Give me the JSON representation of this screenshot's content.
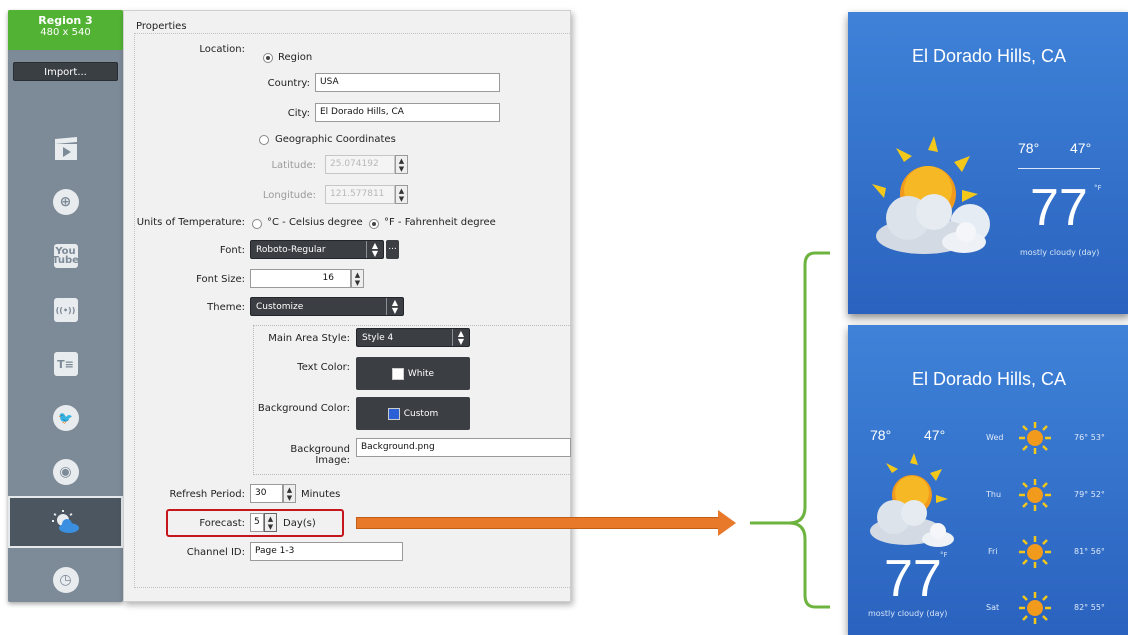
{
  "region": {
    "title": "Region 3",
    "size": "480 x 540"
  },
  "sidebar": {
    "import_label": "Import...",
    "items": [
      {
        "icon": "video-clapper-icon"
      },
      {
        "icon": "globe-icon",
        "glyph": "⊕"
      },
      {
        "icon": "youtube-icon",
        "glyph": "You Tube"
      },
      {
        "icon": "broadcast-icon",
        "glyph": "((•))"
      },
      {
        "icon": "text-icon",
        "glyph": "T≡"
      },
      {
        "icon": "twitter-icon",
        "glyph": "🐦"
      },
      {
        "icon": "rss-icon",
        "glyph": "◉"
      },
      {
        "icon": "weather-icon",
        "selected": true
      },
      {
        "icon": "clock-icon",
        "glyph": "◷"
      }
    ]
  },
  "properties": {
    "title": "Properties",
    "location_label": "Location:",
    "region_option": "Region",
    "country_label": "Country:",
    "country_value": "USA",
    "city_label": "City:",
    "city_value": "El Dorado Hills, CA",
    "geo_option": "Geographic Coordinates",
    "latitude_label": "Latitude:",
    "latitude_value": "25.074192",
    "longitude_label": "Longitude:",
    "longitude_value": "121.577811",
    "units_label": "Units of Temperature:",
    "celsius_option": "°C - Celsius degree",
    "fahrenheit_option": "°F - Fahrenheit degree",
    "font_label": "Font:",
    "font_value": "Roboto-Regular",
    "font_more": "...",
    "font_size_label": "Font Size:",
    "font_size_value": "16",
    "theme_label": "Theme:",
    "theme_value": "Customize",
    "main_area_label": "Main Area Style:",
    "main_area_value": "Style 4",
    "text_color_label": "Text Color:",
    "text_color_value": "White",
    "text_color_swatch": "#ffffff",
    "bg_color_label": "Background Color:",
    "bg_color_value": "Custom",
    "bg_color_swatch": "#2b5fd6",
    "bg_image_label": "Background Image:",
    "bg_image_value": "Background.png",
    "refresh_label": "Refresh Period:",
    "refresh_value": "30",
    "refresh_unit": "Minutes",
    "forecast_label": "Forecast:",
    "forecast_value": "5",
    "forecast_unit": "Day(s)",
    "channel_label": "Channel ID:",
    "channel_value": "Page 1-3"
  },
  "weather_top": {
    "city": "El Dorado Hills, CA",
    "high": "78°",
    "low": "47°",
    "temp": "77",
    "unit": "°F",
    "condition": "mostly cloudy (day)"
  },
  "weather_bottom": {
    "city": "El Dorado Hills, CA",
    "high": "78°",
    "low": "47°",
    "temp": "77",
    "unit": "°F",
    "condition": "mostly cloudy (day)",
    "forecast": [
      {
        "day": "Wed",
        "temps": "76° 53°"
      },
      {
        "day": "Thu",
        "temps": "79° 52°"
      },
      {
        "day": "Fri",
        "temps": "81° 56°"
      },
      {
        "day": "Sat",
        "temps": "82° 55°"
      }
    ]
  },
  "colors": {
    "region_green": "#52b233",
    "highlight_red": "#c4161c",
    "arrow_orange": "#e8792b",
    "bracket_green": "#6db33f",
    "card_blue": "#3474d0"
  }
}
